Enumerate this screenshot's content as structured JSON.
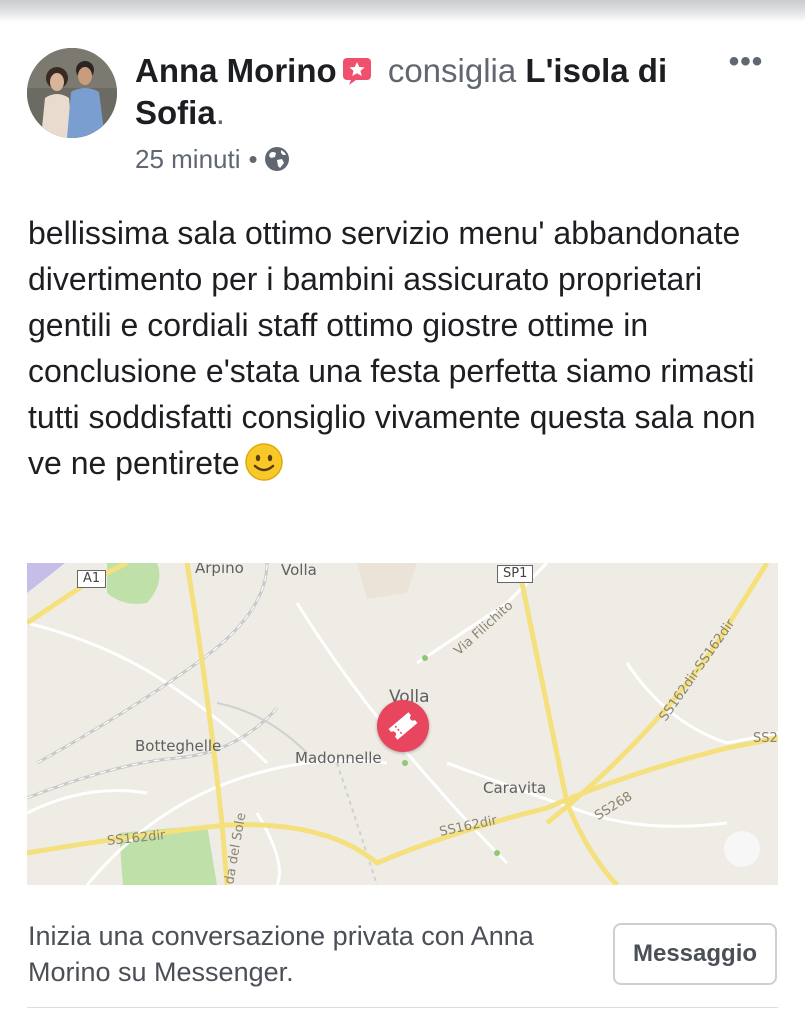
{
  "post": {
    "author": "Anna Morino",
    "verb": "consiglia",
    "page_name": "L'isola di Sofia",
    "page_end": ".",
    "time": "25 minuti",
    "time_sep": "•",
    "text": "bellissima sala ottimo servizio menu' abbandonate divertimento per i bambini assicurato proprietari gentili e cordiali staff ottimo giostre ottime in conclusione e'stata una festa perfetta siamo rimasti tutti soddisfatti consiglio vivamente questa sala non ve ne pentirete"
  },
  "icons": {
    "badge": "recommendation-star-icon",
    "privacy": "globe-icon",
    "emoji": "smiley-icon",
    "more": "more-options-icon",
    "pin": "ticket-pin-icon"
  },
  "map": {
    "labels": {
      "arpino": "Arpino",
      "volla_top": "Volla",
      "volla_center": "Volla",
      "botteghelle": "Botteghelle",
      "madonnelle": "Madonnelle",
      "caravita": "Caravita"
    },
    "roads": {
      "via_filichito": "Via Filichito",
      "ss162dir_a": "SS162dir",
      "ss162dir_b": "SS162dir",
      "ss162dir_c": "SS162dir-SS162dir",
      "ss268": "SS268",
      "ss2": "SS2",
      "strada_del_sole": "ada del Sole"
    },
    "shields": {
      "a1": "A1",
      "sp1": "SP1"
    },
    "colors": {
      "background": "#efece6",
      "major_road": "#f5e07e",
      "pin": "#e8455e",
      "park": "#bfe0a8"
    }
  },
  "cta": {
    "text": "Inizia una conversazione privata con Anna Morino su Messenger.",
    "button": "Messaggio"
  }
}
